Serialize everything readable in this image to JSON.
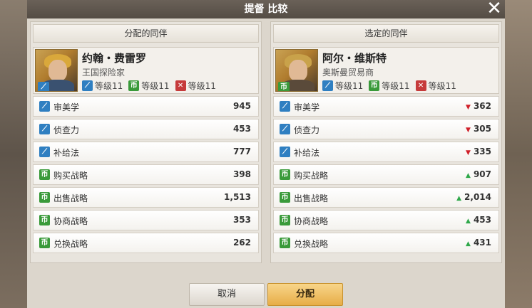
{
  "title": "提督 比较",
  "buttons": {
    "cancel": "取消",
    "assign": "分配"
  },
  "icons": {
    "nav": "compass-icon",
    "trade": "trade-icon",
    "battle": "cross-swords-icon"
  },
  "colors": {
    "nav": "#2f7fc1",
    "trade": "#3a9a3a",
    "battle": "#c63b3b",
    "down": "#d0202a",
    "up": "#2fa84a"
  },
  "left": {
    "header": "分配的同伴",
    "name": "约翰・费雷罗",
    "role": "王国探险家",
    "levels": [
      "等级11",
      "等级11",
      "等级11"
    ],
    "stats": [
      {
        "label": "审美学",
        "value": "945",
        "icon": "nav"
      },
      {
        "label": "侦查力",
        "value": "453",
        "icon": "nav"
      },
      {
        "label": "补给法",
        "value": "777",
        "icon": "nav"
      },
      {
        "label": "购买战略",
        "value": "398",
        "icon": "trade"
      },
      {
        "label": "出售战略",
        "value": "1,513",
        "icon": "trade"
      },
      {
        "label": "协商战略",
        "value": "353",
        "icon": "trade"
      },
      {
        "label": "兑换战略",
        "value": "262",
        "icon": "trade"
      }
    ]
  },
  "right": {
    "header": "选定的同伴",
    "name": "阿尔・维斯特",
    "role": "奥斯曼贸易商",
    "levels": [
      "等级11",
      "等级11",
      "等级11"
    ],
    "stats": [
      {
        "label": "审美学",
        "value": "362",
        "icon": "nav",
        "trend": "down"
      },
      {
        "label": "侦查力",
        "value": "305",
        "icon": "nav",
        "trend": "down"
      },
      {
        "label": "补给法",
        "value": "335",
        "icon": "nav",
        "trend": "down"
      },
      {
        "label": "购买战略",
        "value": "907",
        "icon": "trade",
        "trend": "up"
      },
      {
        "label": "出售战略",
        "value": "2,014",
        "icon": "trade",
        "trend": "up"
      },
      {
        "label": "协商战略",
        "value": "453",
        "icon": "trade",
        "trend": "up"
      },
      {
        "label": "兑换战略",
        "value": "431",
        "icon": "trade",
        "trend": "up"
      }
    ]
  }
}
